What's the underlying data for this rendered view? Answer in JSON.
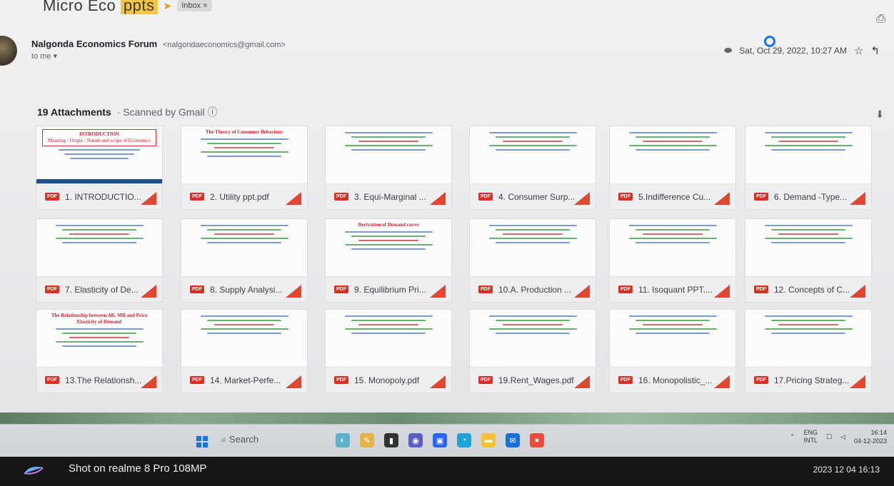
{
  "email": {
    "subject_prefix": "Micro Eco",
    "subject_highlight": "ppts",
    "label": "Inbox ×",
    "sender_name": "Nalgonda Economics Forum",
    "sender_email": "<nalgondaeconomics@gmail.com>",
    "to": "to me ▾",
    "date": "Sat, Oct 29, 2022, 10:27 AM"
  },
  "attachments": {
    "count_label": "19 Attachments",
    "scanned_label": "· Scanned by Gmail ⓘ",
    "items": [
      {
        "name": "1. INTRODUCTIO..."
      },
      {
        "name": "2. Utility ppt.pdf"
      },
      {
        "name": "3. Equi-Marginal ..."
      },
      {
        "name": "4. Consumer Surp..."
      },
      {
        "name": "5.Indifference Cu..."
      },
      {
        "name": "6. Demand -Type..."
      },
      {
        "name": "7. Elasticity of De..."
      },
      {
        "name": "8. Supply Analysi..."
      },
      {
        "name": "9. Equilibrium Pri..."
      },
      {
        "name": "10.A. Production ..."
      },
      {
        "name": "11. Isoquant PPT...."
      },
      {
        "name": "12. Concepts of C..."
      },
      {
        "name": "13.The Relationsh..."
      },
      {
        "name": "14. Market-Perfe..."
      },
      {
        "name": "15. Monopoly.pdf"
      },
      {
        "name": "19.Rent_Wages.pdf"
      },
      {
        "name": "16. Monopolistic_..."
      },
      {
        "name": "17.Pricing Strateg..."
      }
    ],
    "pdf_badge": "PDF"
  },
  "thumbs": {
    "intro_title": "INTRODUCTION",
    "intro_sub": "Meaning - Origin - Nature and scope of Economics",
    "utility_title": "The Theory of Consumer Behaviour",
    "demand_curve_title": "Derivation of Demand curve",
    "relationship_title": "The Relationship between AR, MR and Price Elasticity of Demand"
  },
  "taskbar": {
    "search": "Search",
    "lang_top": "ENG",
    "lang_bottom": "INTL",
    "time": "16:14",
    "date": "04-12-2023"
  },
  "photo": {
    "watermark": "Shot on realme 8 Pro 108MP",
    "timestamp": "2023 12 04 16:13"
  }
}
